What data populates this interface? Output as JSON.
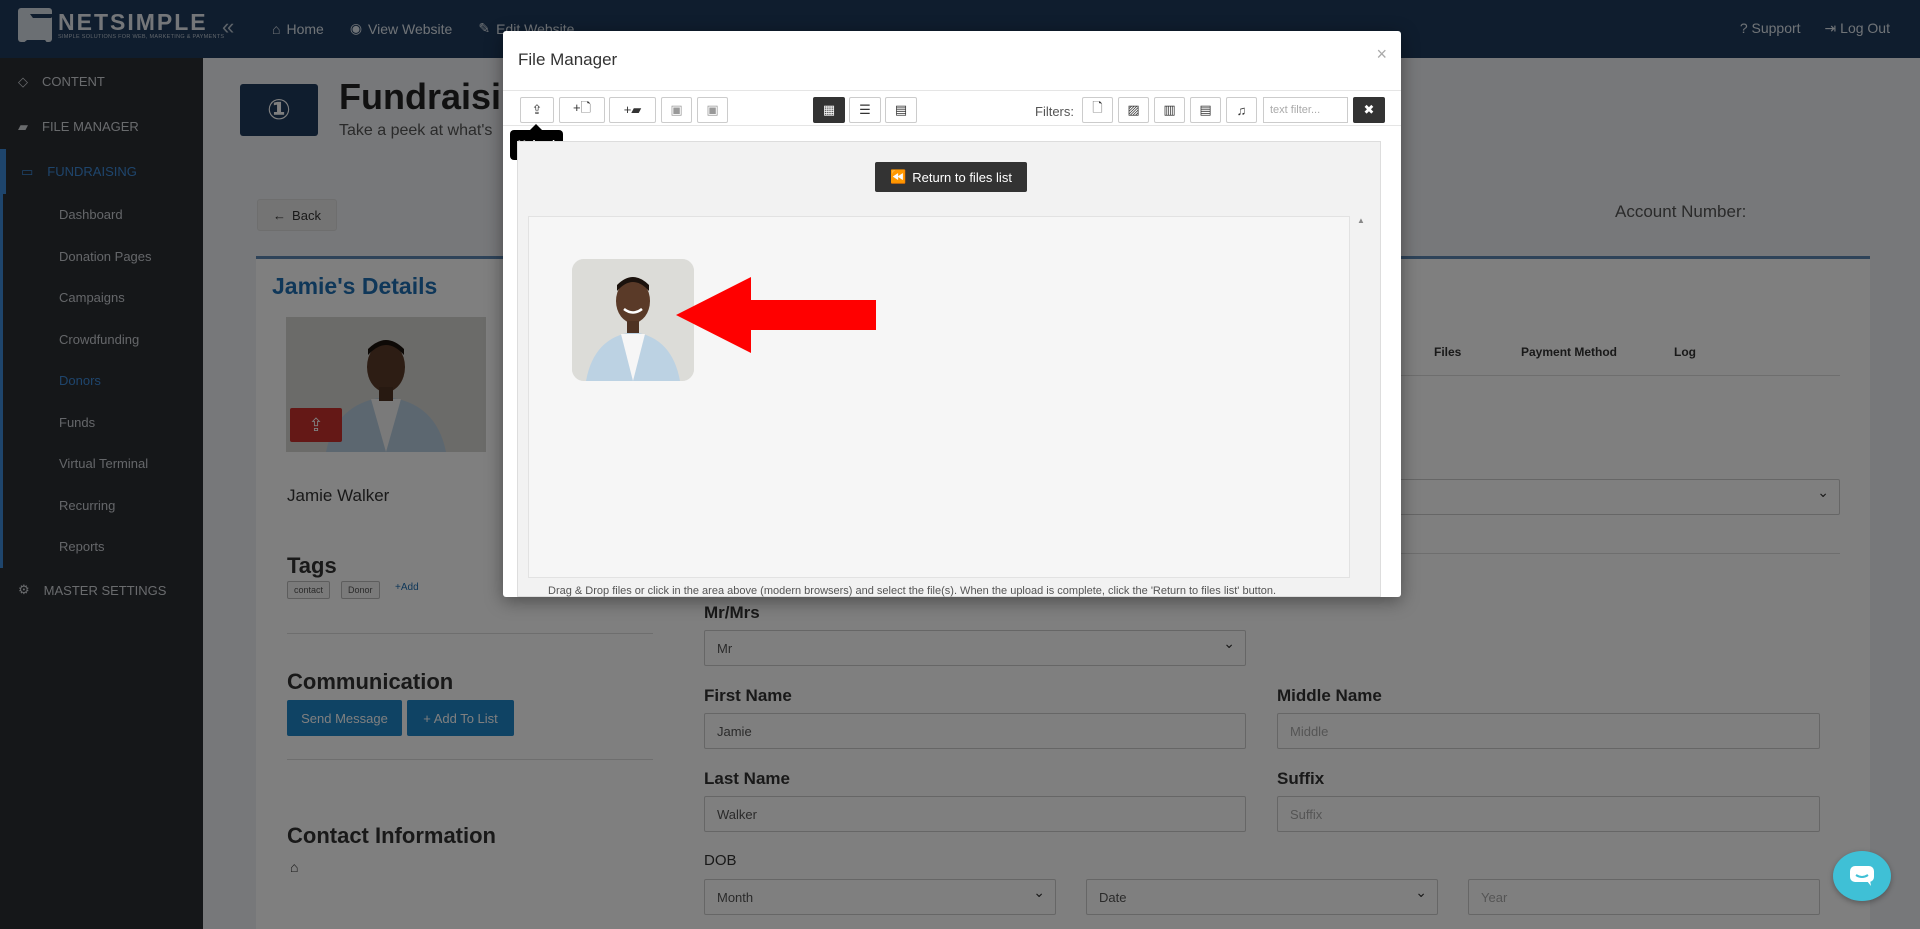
{
  "topbar": {
    "logo_name": "NETSIMPLE",
    "logo_tagline": "SIMPLE SOLUTIONS FOR WEB, MARKETING & PAYMENTS",
    "nav": [
      {
        "label": "Home"
      },
      {
        "label": "View Website"
      },
      {
        "label": "Edit Website"
      }
    ],
    "support": "Support",
    "logout": "Log Out"
  },
  "sidebar": {
    "sections": [
      {
        "label": "CONTENT"
      },
      {
        "label": "FILE MANAGER"
      },
      {
        "label": "FUNDRAISING"
      }
    ],
    "fundraising_items": [
      {
        "label": "Dashboard"
      },
      {
        "label": "Donation Pages"
      },
      {
        "label": "Campaigns"
      },
      {
        "label": "Crowdfunding"
      },
      {
        "label": "Donors"
      },
      {
        "label": "Funds"
      },
      {
        "label": "Virtual Terminal"
      },
      {
        "label": "Recurring"
      },
      {
        "label": "Reports"
      }
    ],
    "master_settings": "MASTER SETTINGS",
    "active_item": "Donors"
  },
  "page": {
    "title": "Fundraisin",
    "subtitle": "Take a peek at what's",
    "back": "Back",
    "account_label": "Account Number:",
    "donor_heading": "Jamie's Details",
    "donor_name": "Jamie Walker",
    "tags_heading": "Tags",
    "tags": [
      "contact",
      "Donor"
    ],
    "tag_add": "+Add",
    "communication_heading": "Communication",
    "send_message": "Send Message",
    "add_to_list": "+ Add To List",
    "contact_heading": "Contact Information",
    "tabs": [
      "Files",
      "Payment Method",
      "Log"
    ],
    "form": {
      "mrmrs_label": "Mr/Mrs",
      "mrmrs_value": "Mr",
      "first_name_label": "First Name",
      "first_name_value": "Jamie",
      "middle_name_label": "Middle Name",
      "middle_name_placeholder": "Middle",
      "last_name_label": "Last Name",
      "last_name_value": "Walker",
      "suffix_label": "Suffix",
      "suffix_placeholder": "Suffix",
      "dob_label": "DOB",
      "dob_month": "Month",
      "dob_date": "Date",
      "dob_year_placeholder": "Year"
    }
  },
  "modal": {
    "title": "File Manager",
    "close": "×",
    "filters_label": "Filters:",
    "filter_placeholder": "text filter...",
    "tooltip": "Upload",
    "return_button": "Return to files list",
    "drop_note": "Drag & Drop files or click in the area above (modern browsers) and select the file(s). When the upload is complete, click the 'Return to files list' button."
  },
  "colors": {
    "topbar": "#1e3a5c",
    "sidebar": "#2b2e33",
    "accent": "#3d8ad8",
    "arrow": "#ff0000",
    "upload_btn": "#c9302c",
    "blue_btn": "#1f86c8",
    "chat": "#3fc0d6"
  }
}
